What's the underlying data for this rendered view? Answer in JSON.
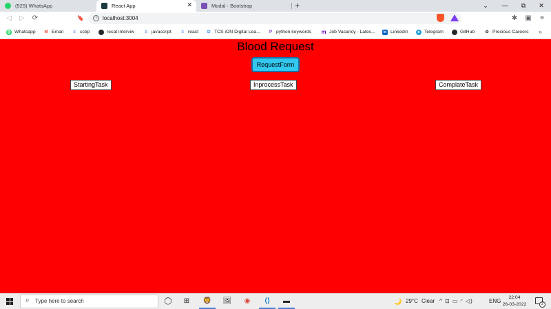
{
  "browser": {
    "tabs": [
      {
        "title": "(525) WhatsApp",
        "favicon_color": "#25d366"
      },
      {
        "title": "React App",
        "favicon_color": "#1f3a3f"
      },
      {
        "title": "Modal · Bootstrap",
        "favicon_color": "#7952b3"
      }
    ],
    "new_tab": "+",
    "close_glyph": "✕",
    "window_controls": {
      "minimize": "—",
      "restore": "⧉",
      "close": "✕",
      "tab_list": "⌄"
    },
    "nav": {
      "back": "◁",
      "forward": "▷",
      "reload": "⟳",
      "bookmark": "🔖"
    },
    "url": "localhost:3004",
    "info_glyph": "i",
    "bookmarks": [
      {
        "label": "Whatsapp",
        "icon": "whatsapp-icon",
        "color": "#25d366",
        "glyph": "◎"
      },
      {
        "label": "Email",
        "icon": "gmail-icon",
        "color": "#ea4335",
        "glyph": "M"
      },
      {
        "label": "ccbp",
        "icon": "ccbp-icon",
        "color": "#1d4ed8",
        "glyph": "≡"
      },
      {
        "label": "recat interviw",
        "icon": "github-icon",
        "color": "#24292e",
        "glyph": "●"
      },
      {
        "label": "javascript",
        "icon": "ccbp-icon",
        "color": "#1d4ed8",
        "glyph": "≡"
      },
      {
        "label": "react",
        "icon": "ccbp-icon",
        "color": "#1d4ed8",
        "glyph": "≡"
      },
      {
        "label": "TCS iON Digital Lea...",
        "icon": "tcs-icon",
        "color": "#1a73e8",
        "glyph": "⏻"
      },
      {
        "label": "python keywords",
        "icon": "python-icon",
        "color": "#7b2cbf",
        "glyph": "P"
      },
      {
        "label": "Job Vacancy - Lates...",
        "icon": "jobs-icon",
        "color": "#6a0dad",
        "glyph": "m"
      },
      {
        "label": "LinkedIn",
        "icon": "linkedin-icon",
        "color": "#0a66c2",
        "glyph": "in"
      },
      {
        "label": "Telegram",
        "icon": "telegram-icon",
        "color": "#229ed9",
        "glyph": "➤"
      },
      {
        "label": "GitHub",
        "icon": "github-icon",
        "color": "#24292e",
        "glyph": "●"
      },
      {
        "label": "Precious Careers",
        "icon": "careers-icon",
        "color": "#444444",
        "glyph": "✿"
      }
    ],
    "bookmarks_more": "»",
    "toolbar_icons": {
      "extensions": "✱",
      "wallet": "▣",
      "menu": "≡"
    }
  },
  "page": {
    "background": "#ff0000",
    "title": "Blood Request",
    "request_button": "RequestForm",
    "tasks": [
      "StartingTask",
      "InprocessTask",
      "ComplateTask"
    ]
  },
  "taskbar": {
    "search_placeholder": "Type here to search",
    "search_glyph": "⌕",
    "task_view_glyph": "◯",
    "widgets_glyph": "⊞",
    "apps": [
      {
        "name": "brave-icon",
        "glyph": "🦁"
      },
      {
        "name": "photos-icon",
        "glyph": "🖼"
      },
      {
        "name": "chrome-icon",
        "glyph": "◉"
      },
      {
        "name": "vscode-icon",
        "glyph": "⟨⟩"
      },
      {
        "name": "terminal-icon",
        "glyph": "▬"
      }
    ],
    "weather": {
      "glyph": "🌙",
      "temp": "29°C",
      "condition": "Clear"
    },
    "tray_glyphs": "^ ⊡ ▭ ◜ ◁)",
    "language": "ENG",
    "time": "22:04",
    "date": "26-03-2022",
    "notification_count": "2"
  }
}
